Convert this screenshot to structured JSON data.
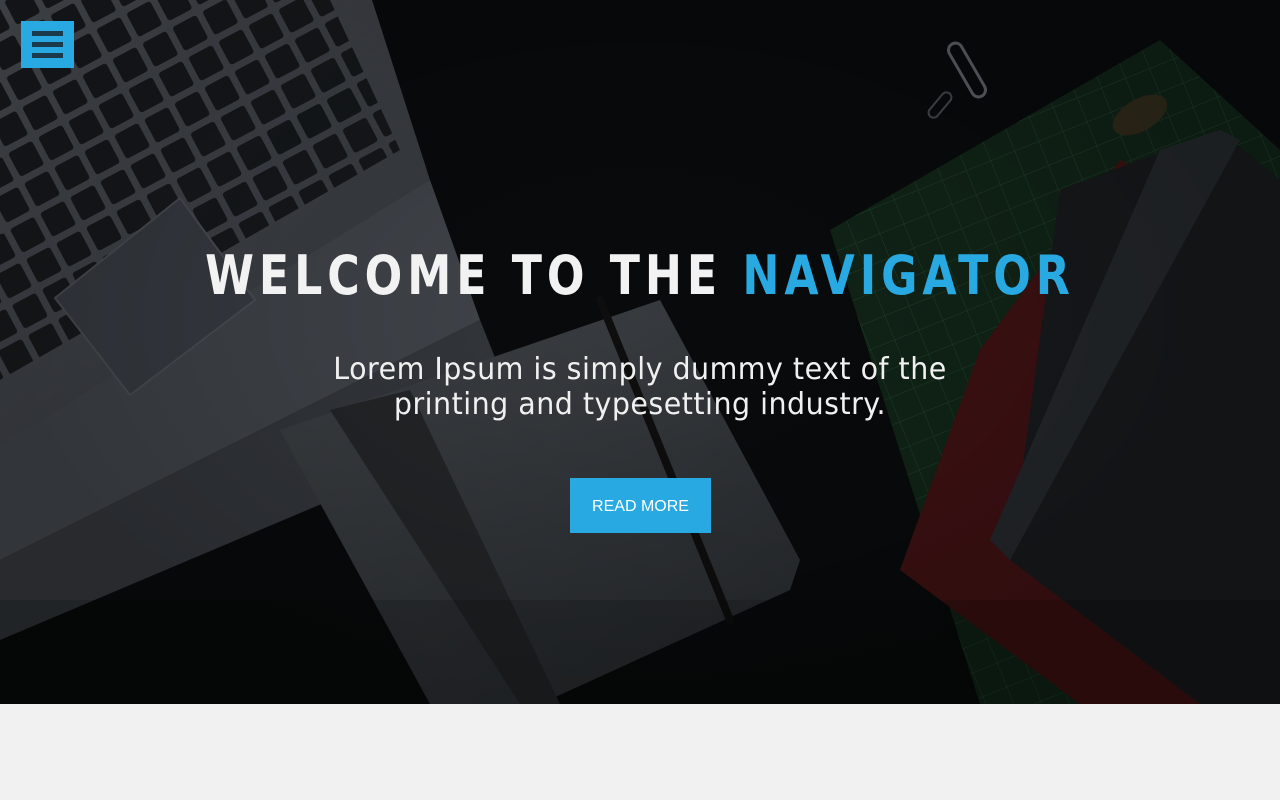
{
  "menu": {
    "icon": "hamburger-menu-icon",
    "color": "#29a9e1"
  },
  "hero": {
    "title_prefix": "WELCOME TO THE",
    "title_accent": "NAVIGATOR",
    "subtitle": "Lorem Ipsum is simply dummy text of the printing and typesetting industry.",
    "button_label": "READ MORE",
    "accent_color": "#29a9e1"
  }
}
